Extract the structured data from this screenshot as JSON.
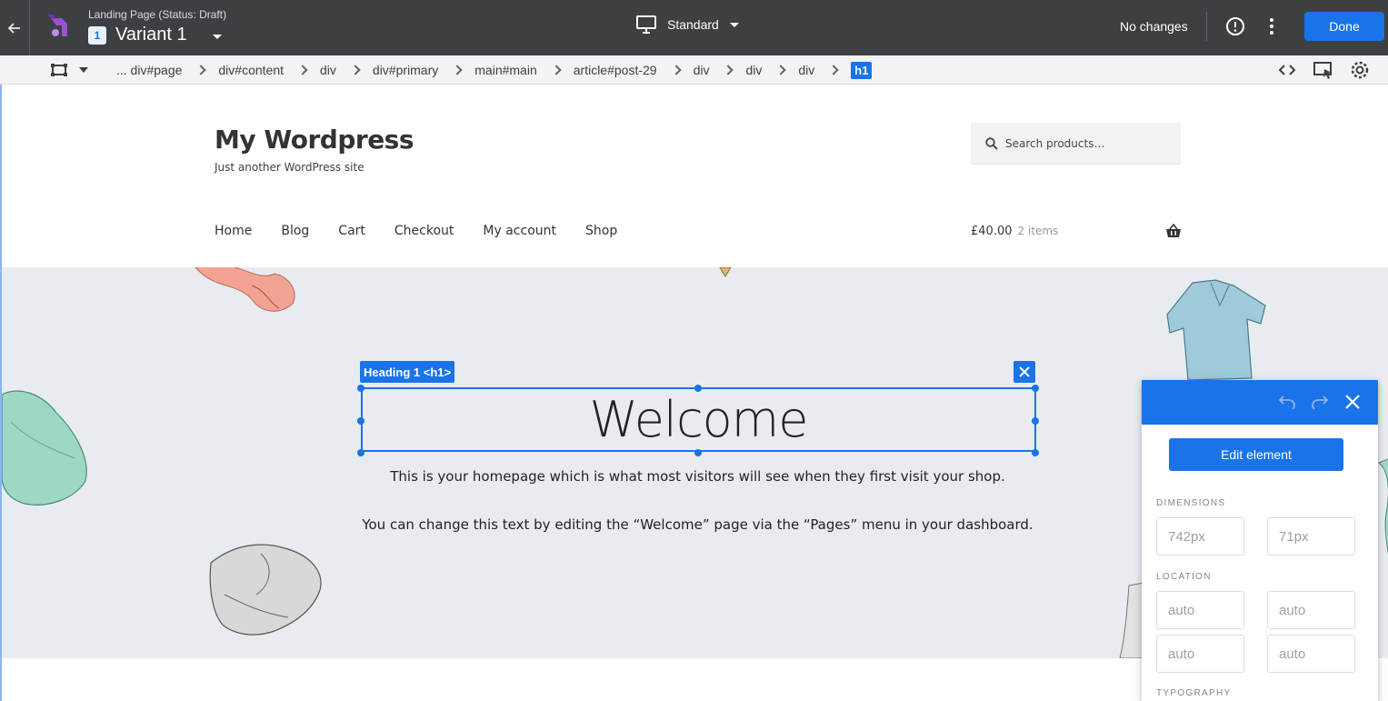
{
  "topbar": {
    "page_status": "Landing Page (Status: Draft)",
    "variant_number": "1",
    "variant_name": "Variant 1",
    "device": "Standard",
    "changes_status": "No changes",
    "done_label": "Done"
  },
  "breadcrumb": {
    "items": [
      "... div#page",
      "div#content",
      "div",
      "div#primary",
      "main#main",
      "article#post-29",
      "div",
      "div",
      "div",
      "h1"
    ],
    "active_index": 9
  },
  "site": {
    "title": "My Wordpress",
    "tagline": "Just another WordPress site",
    "search_placeholder": "Search products…",
    "nav": [
      "Home",
      "Blog",
      "Cart",
      "Checkout",
      "My account",
      "Shop"
    ],
    "cart_total": "£40.00",
    "cart_count": "2 items"
  },
  "hero": {
    "selection_tag": "Heading 1 <h1>",
    "heading": "Welcome",
    "paragraph_1": "This is your homepage which is what most visitors will see when they first visit your shop.",
    "paragraph_2": "You can change this text by editing the “Welcome” page via the “Pages” menu in your dashboard."
  },
  "panel": {
    "edit_label": "Edit element",
    "dimensions_label": "DIMENSIONS",
    "width_placeholder": "742px",
    "height_placeholder": "71px",
    "location_label": "LOCATION",
    "location_placeholders": [
      "auto",
      "auto",
      "auto",
      "auto"
    ],
    "typography_label": "TYPOGRAPHY"
  },
  "colors": {
    "topbar_bg": "#3c4043",
    "accent": "#1a73e8",
    "hero_bg": "#e8ecf1"
  }
}
